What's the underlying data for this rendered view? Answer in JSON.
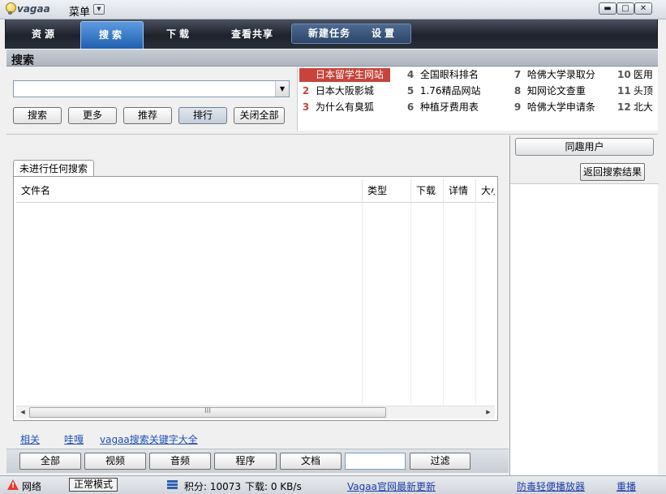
{
  "titlebar": {
    "brand": "vagaa",
    "menu_label": "菜单",
    "menu_arrow": "▼",
    "minimize": "▬",
    "maximize": "□",
    "close": "✕"
  },
  "nav": {
    "resources": "资源",
    "search": "搜索",
    "download": "下载",
    "share": "查看共享",
    "new_task": "新建任务",
    "settings": "设置"
  },
  "search": {
    "section_title": "搜索",
    "input_value": "",
    "drop_arrow": "▼",
    "buttons": {
      "search": "搜索",
      "more": "更多",
      "recommend": "推荐",
      "rank": "排行",
      "close_all": "关闭全部"
    }
  },
  "hotlist": [
    {
      "num": "1",
      "text": "日本留学生网站"
    },
    {
      "num": "2",
      "text": "日本大阪影城"
    },
    {
      "num": "3",
      "text": "为什么有臭狐"
    },
    {
      "num": "4",
      "text": "全国眼科排名"
    },
    {
      "num": "5",
      "text": "1.76精品网站"
    },
    {
      "num": "6",
      "text": "种植牙费用表"
    },
    {
      "num": "7",
      "text": "哈佛大学录取分"
    },
    {
      "num": "8",
      "text": "知网论文查重"
    },
    {
      "num": "9",
      "text": "哈佛大学申请条"
    },
    {
      "num": "10",
      "text": "医用"
    },
    {
      "num": "11",
      "text": "头顶"
    },
    {
      "num": "12",
      "text": "北大"
    }
  ],
  "results": {
    "tab_label": "未进行任何搜索",
    "columns": [
      "文件名",
      "类型",
      "下载",
      "详情",
      "大小"
    ],
    "scroll_left": "◀",
    "scroll_right": "▶",
    "scroll_grip": "III"
  },
  "links": {
    "related": "相关",
    "wa": "哇嘎",
    "keywords": "vagaa搜索关键字大全"
  },
  "filters": {
    "all": "全部",
    "video": "视频",
    "audio": "音频",
    "program": "程序",
    "document": "文档",
    "filter_value": "",
    "filter": "过滤"
  },
  "right": {
    "co_users": "同趣用户",
    "back": "返回搜索结果"
  },
  "status": {
    "network": "网络",
    "mode": "正常模式",
    "score": "积分: 10073",
    "download": "下载: 0 KB/s",
    "update_link": "Vagaa官网最新更新",
    "player_link": "防毒轻便播放器",
    "replay_link": "重播"
  }
}
